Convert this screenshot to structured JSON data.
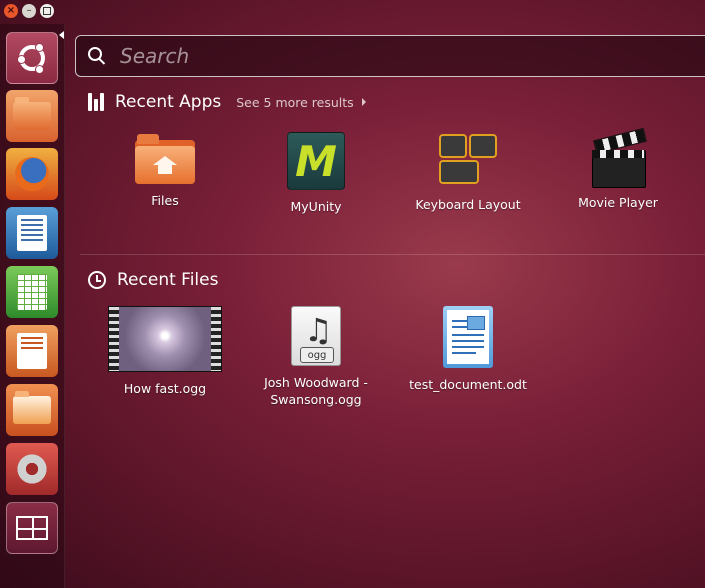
{
  "window": {
    "close_glyph": "×",
    "min_glyph": "–"
  },
  "launcher": {
    "items": [
      {
        "name": "Dash home",
        "icon": "ubuntu-logo-icon"
      },
      {
        "name": "Files",
        "icon": "folder-icon"
      },
      {
        "name": "Firefox",
        "icon": "firefox-icon"
      },
      {
        "name": "LibreOffice Writer",
        "icon": "writer-icon"
      },
      {
        "name": "LibreOffice Calc",
        "icon": "calc-icon"
      },
      {
        "name": "LibreOffice Impress",
        "icon": "impress-icon"
      },
      {
        "name": "Ubuntu Software Center",
        "icon": "store-bag-icon"
      },
      {
        "name": "System Settings",
        "icon": "settings-icon"
      },
      {
        "name": "Workspace Switcher",
        "icon": "workspace-icon"
      }
    ]
  },
  "search": {
    "placeholder": "Search"
  },
  "recent_apps": {
    "title": "Recent Apps",
    "see_more": "See 5 more results",
    "items": [
      {
        "label": "Files"
      },
      {
        "label": "MyUnity",
        "glyph": "M"
      },
      {
        "label": "Keyboard Layout"
      },
      {
        "label": "Movie Player"
      }
    ]
  },
  "recent_files": {
    "title": "Recent Files",
    "items": [
      {
        "label": "How fast.ogg"
      },
      {
        "label": "Josh Woodward -\nSwansong.ogg",
        "note_glyph": "♫",
        "tag": "ogg"
      },
      {
        "label": "test_document.odt"
      }
    ]
  },
  "colors": {
    "accent": "#7a2038",
    "launcher_bg": "#3a0c1a",
    "text": "#ffffff"
  }
}
